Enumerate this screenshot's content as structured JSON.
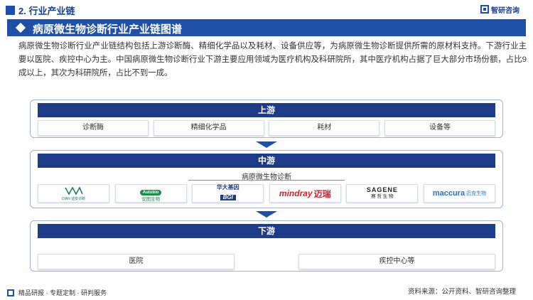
{
  "header": {
    "section": "2. 行业产业链",
    "brand": "智研咨询"
  },
  "title": "病原微生物诊断行业产业链图谱",
  "intro": "病原微生物诊断行业产业链结构包括上游诊断酶、精细化学品以及耗材、设备供应等，为病原微生物诊断提供所需的原材料支持。下游行业主要以医院、疾控中心为主。中国病原微生物诊断行业下游主要应用领域为医疗机构及科研院所，其中医疗机构占据了巨大部分市场份额，占比9成以上，其次为科研院所，占比不到一成。",
  "upstream": {
    "label": "上游",
    "items": [
      "诊断酶",
      "精细化学品",
      "耗材",
      "设备等"
    ]
  },
  "midstream": {
    "label": "中游",
    "sub": "病原微生物诊断",
    "logos": [
      {
        "text": "DIAN",
        "caption": "DIAN 迪安诊断"
      },
      {
        "text": "Autobio",
        "caption": "安图生物"
      },
      {
        "text": "华大基因",
        "caption": "BGI"
      },
      {
        "text": "mindray",
        "caption": "迈瑞"
      },
      {
        "text": "SAGENE",
        "caption": "赛 哲 生 物"
      },
      {
        "text": "maccura",
        "caption": "迈克生物"
      }
    ]
  },
  "downstream": {
    "label": "下游",
    "items": [
      "医院",
      "疾控中心等"
    ]
  },
  "footer": {
    "left": "精品研报 · 专题定制 · 研判服务",
    "source": "资料来源：公开资料、智研咨询整理"
  },
  "colors": {
    "primary": "#1d50a6",
    "section_head": "#1d3b86",
    "arrow": "#1d50a6",
    "mindray_red": "#d71e2b",
    "maccura_blue": "#2a6fd1"
  },
  "icons": [
    "section-marker-icon",
    "brand-logo-icon",
    "diamond-icon",
    "down-arrow-icon"
  ]
}
